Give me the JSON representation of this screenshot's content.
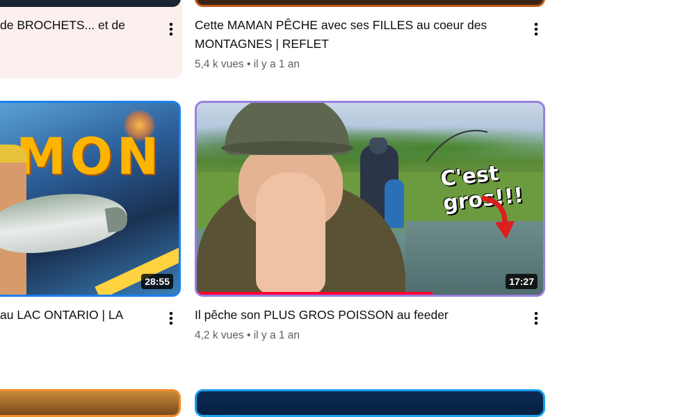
{
  "videos": [
    {
      "title": "de BROCHETS... et de",
      "meta": "",
      "duration": ""
    },
    {
      "title_line1": "Cette MAMAN PÊCHE avec ses FILLES au coeur des",
      "title_line2": "MONTAGNES | REFLET",
      "meta": "5,4 k vues • il y a 1 an",
      "duration": ""
    },
    {
      "title": "au LAC ONTARIO | LA",
      "meta": "",
      "duration": "28:55",
      "thumb_text": "MON"
    },
    {
      "title": "Il pêche son PLUS GROS POISSON au feeder",
      "meta": "4,2 k vues • il y a 1 an",
      "duration": "17:27",
      "thumb_text": "C'est gros!!!",
      "watched_fraction": 0.68
    }
  ],
  "colors": {
    "progress": "#ff0033",
    "card_highlight": "#fbf0ee",
    "thumb_border_blue": "#1a7ff0",
    "thumb_border_purple": "#9a7fe0",
    "thumb_border_orange": "#f08a2a"
  },
  "icons": {
    "more": "more-vert-icon",
    "arrow": "red-arrow-icon"
  }
}
